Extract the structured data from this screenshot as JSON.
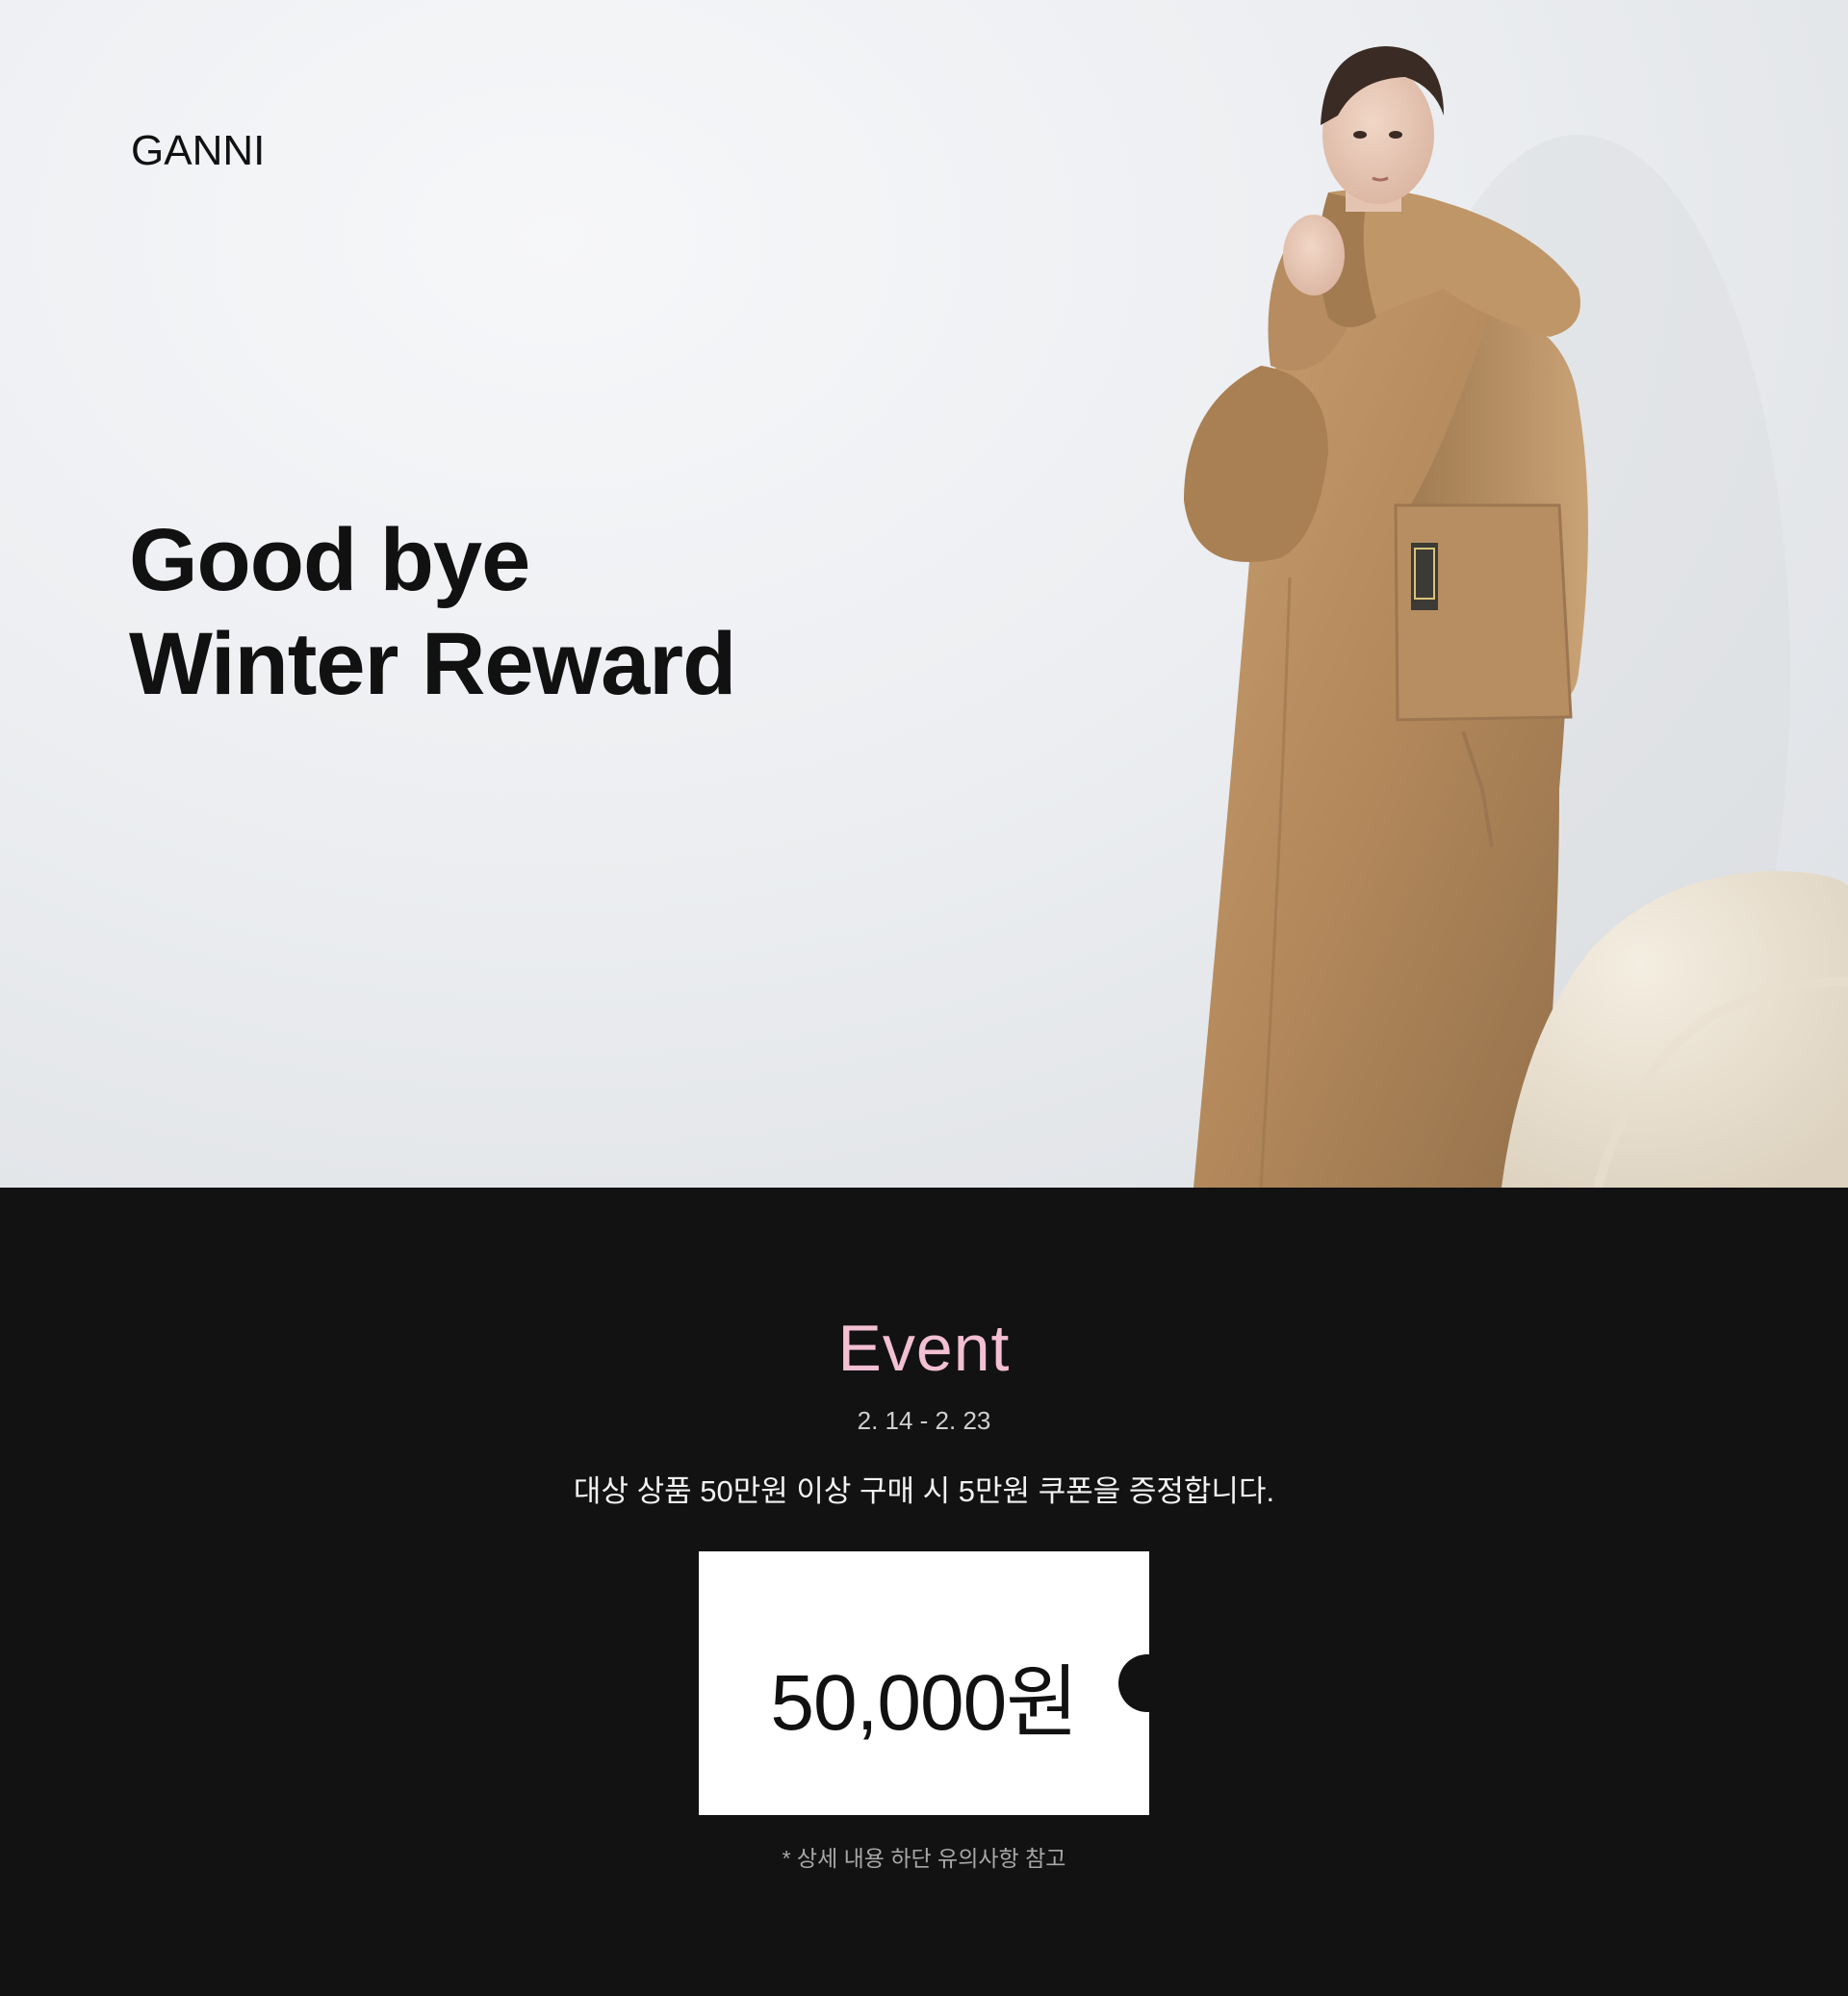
{
  "hero": {
    "brand": "GANNI",
    "headline_line1": "Good bye",
    "headline_line2": "Winter Reward",
    "background_color": "#eceef1",
    "coat_color": "#b58e62"
  },
  "event": {
    "title": "Event",
    "period": "2. 14 - 2. 23",
    "description": "대상 상품 50만원 이상 구매 시 5만원 쿠폰을 증정합니다.",
    "coupon_amount": "50,000원",
    "note": "* 상세 내용 하단 유의사항 참고",
    "title_color": "#f2bfd3",
    "background_color": "#121212"
  }
}
